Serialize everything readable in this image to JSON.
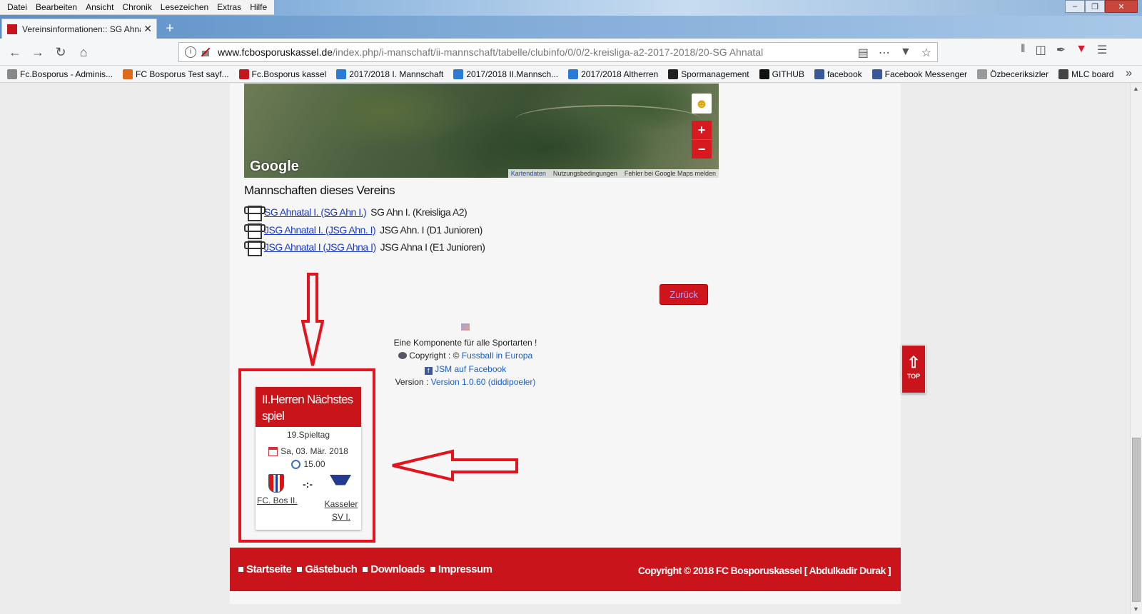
{
  "menubar": {
    "items": [
      "Datei",
      "Bearbeiten",
      "Ansicht",
      "Chronik",
      "Lesezeichen",
      "Extras",
      "Hilfe"
    ]
  },
  "tab": {
    "title": "Vereinsinformationen:: SG Ahnatal"
  },
  "url": {
    "domain": "www.fcbosporuskassel.de",
    "path": "/index.php/i-manschaft/ii-mannschaft/tabelle/clubinfo/0/0/2-kreisliga-a2-2017-2018/20-SG Ahnatal"
  },
  "bookmarks": [
    {
      "label": "Fc.Bosporus - Adminis...",
      "color": "#888888"
    },
    {
      "label": "FC Bosporus Test sayf...",
      "color": "#e06a1a"
    },
    {
      "label": "Fc.Bosporus kassel",
      "color": "#c4161c"
    },
    {
      "label": "2017/2018 I. Mannschaft",
      "color": "#2a7ad8"
    },
    {
      "label": "2017/2018 II.Mannsch...",
      "color": "#2a7ad8"
    },
    {
      "label": "2017/2018 Altherren",
      "color": "#2a7ad8"
    },
    {
      "label": "Spormanagement",
      "color": "#222222"
    },
    {
      "label": "GITHUB",
      "color": "#111111"
    },
    {
      "label": "facebook",
      "color": "#3b5998"
    },
    {
      "label": "Facebook Messenger",
      "color": "#3b5998"
    },
    {
      "label": "Özbeceriksizler",
      "color": "#999999"
    },
    {
      "label": "MLC board",
      "color": "#444444"
    }
  ],
  "map": {
    "logo": "Google",
    "attribution": [
      "Kartendaten",
      "Nutzungsbedingungen",
      "Fehler bei Google Maps melden"
    ],
    "zoom_in": "+",
    "zoom_out": "−"
  },
  "teams": {
    "heading": "Mannschaften dieses Vereins",
    "items": [
      {
        "link": "SG Ahnatal I. (SG Ahn I.)",
        "rest": "SG Ahn I. (Kreisliga A2)"
      },
      {
        "link": "JSG Ahnatal I. (JSG Ahn. I)",
        "rest": "JSG Ahn. I (D1 Junioren)"
      },
      {
        "link": "JSG Ahnatal I (JSG Ahna I)",
        "rest": "JSG Ahna I (E1 Junioren)"
      }
    ]
  },
  "back_button": "Zurück",
  "component": {
    "line1": "Eine Komponente für alle Sportarten !",
    "copyright_prefix": "Copyright : ©",
    "copyright_link": "Fussball in Europa",
    "facebook_link": "JSM auf Facebook",
    "version_prefix": "Version :",
    "version_link": "Version 1.0.60 (diddipoeler)"
  },
  "next_match": {
    "title": "II.Herren Nächstes spiel",
    "matchday": "19.Spieltag",
    "date": "Sa, 03. Mär. 2018",
    "time": "15.00",
    "separator": "-:-",
    "home": "FC. Bos II.",
    "away": "Kasseler SV I."
  },
  "footer": {
    "links": [
      "Startseite",
      "Gästebuch",
      "Downloads",
      "Impressum"
    ],
    "copyright": "Copyright © 2018 FC Bosporuskassel [ Abdulkadir Durak ]"
  },
  "top_button": "TOP",
  "colors": {
    "brand_red": "#c8141a",
    "annotation_red": "#e3141c",
    "link_blue": "#1a3cc8"
  }
}
